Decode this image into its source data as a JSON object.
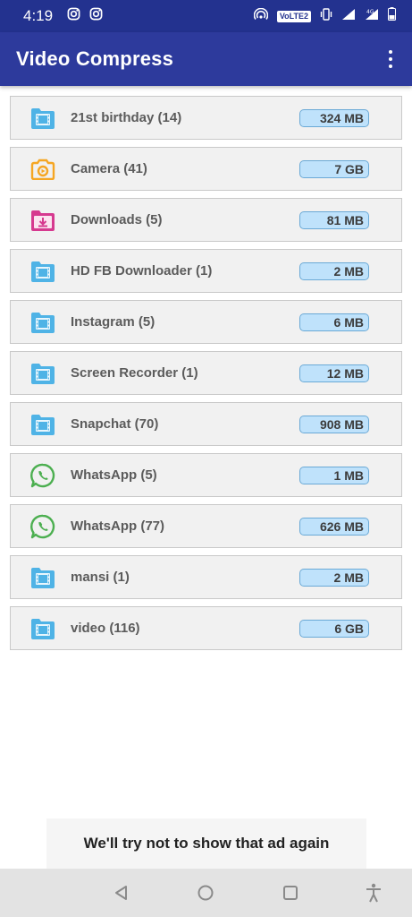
{
  "status_bar": {
    "time": "4:19",
    "network_badge": "VoLTE2",
    "notification_icons": [
      "instagram-icon",
      "instagram-icon"
    ],
    "system_icons": [
      "hotspot-icon",
      "volte-icon",
      "vibrate-icon",
      "signal-icon",
      "signal-4g-icon",
      "battery-icon"
    ]
  },
  "app_bar": {
    "title": "Video Compress",
    "menu_icon": "more-vert-icon"
  },
  "folders": [
    {
      "label": "21st birthday (14)",
      "size": "324 MB",
      "icon": "folder-video-icon"
    },
    {
      "label": "Camera (41)",
      "size": "7 GB",
      "icon": "camera-icon"
    },
    {
      "label": "Downloads (5)",
      "size": "81 MB",
      "icon": "download-icon"
    },
    {
      "label": "HD FB Downloader (1)",
      "size": "2 MB",
      "icon": "folder-video-icon"
    },
    {
      "label": "Instagram (5)",
      "size": "6 MB",
      "icon": "folder-video-icon"
    },
    {
      "label": "Screen Recorder (1)",
      "size": "12 MB",
      "icon": "folder-video-icon"
    },
    {
      "label": "Snapchat (70)",
      "size": "908 MB",
      "icon": "folder-video-icon"
    },
    {
      "label": "WhatsApp (5)",
      "size": "1 MB",
      "icon": "whatsapp-icon"
    },
    {
      "label": "WhatsApp (77)",
      "size": "626 MB",
      "icon": "whatsapp-icon"
    },
    {
      "label": "mansi (1)",
      "size": "2 MB",
      "icon": "folder-video-icon"
    },
    {
      "label": "video (116)",
      "size": "6 GB",
      "icon": "folder-video-icon"
    }
  ],
  "ad_banner": {
    "text": "We'll try not to show that ad again"
  },
  "nav_bar": {
    "buttons": [
      "back-icon",
      "home-icon",
      "recents-icon",
      "accessibility-icon"
    ]
  },
  "colors": {
    "status_bar": "#23328f",
    "app_bar": "#2d3a9c",
    "row_background": "#f1f1f1",
    "badge_fill": "#bfe2fb",
    "badge_border": "#6aa9d6",
    "folder_icon": "#4fb3e6",
    "camera_icon": "#f5a623",
    "download_icon": "#d6398f",
    "whatsapp_icon": "#4caf50"
  }
}
